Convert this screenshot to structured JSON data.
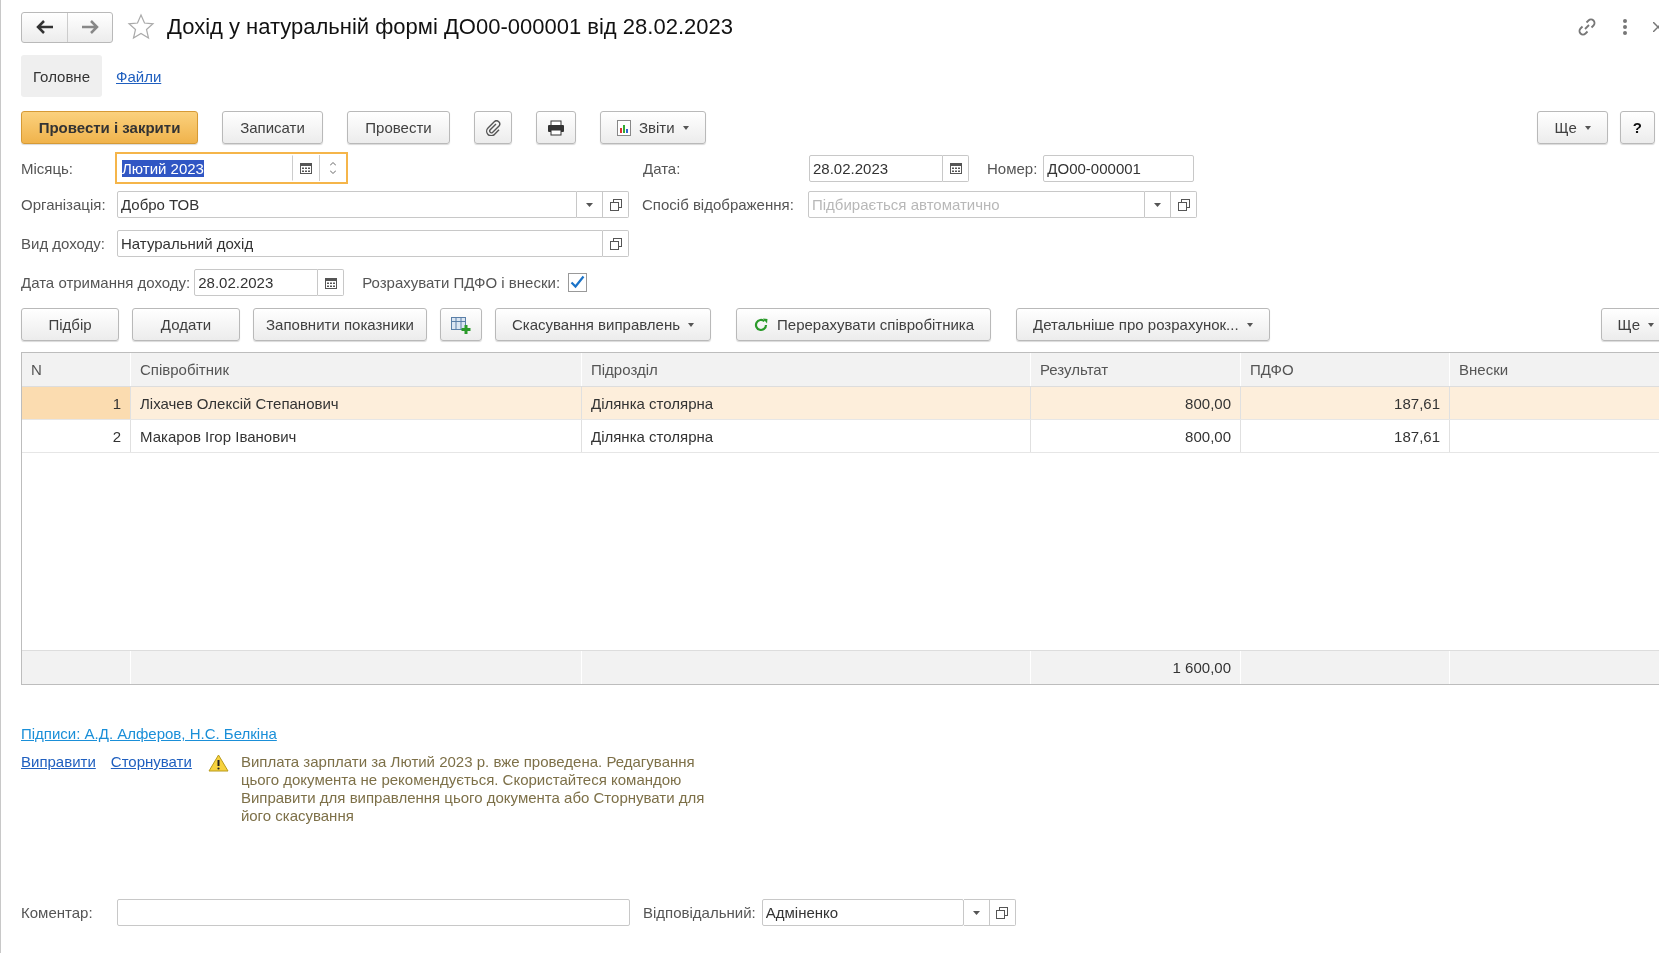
{
  "window": {
    "title": "Дохід у натуральній формі ДО00-000001 від 28.02.2023",
    "favorite": false
  },
  "tabs": [
    {
      "label": "Головне",
      "selected": true
    },
    {
      "label": "Файли",
      "selected": false
    }
  ],
  "toolbar": {
    "post_and_close": "Провести і закрити",
    "save": "Записати",
    "post": "Провести",
    "reports": "Звіти",
    "more": "Ще",
    "help": "?"
  },
  "month": {
    "label": "Місяць:",
    "value": "Лютий 2023",
    "focused": true
  },
  "date": {
    "label": "Дата:",
    "value": "28.02.2023"
  },
  "number": {
    "label": "Номер:",
    "value": "ДО00-000001"
  },
  "organization": {
    "label": "Організація:",
    "value": "Добро ТОВ"
  },
  "display_method": {
    "label": "Спосіб відображення:",
    "placeholder": "Підбирається автоматично"
  },
  "income_type": {
    "label": "Вид доходу:",
    "value": "Натуральний дохід"
  },
  "receipt_date": {
    "label": "Дата отримання доходу:",
    "value": "28.02.2023"
  },
  "calculate_pdfo": {
    "label": "Розрахувати ПДФО і внески:",
    "checked": true
  },
  "table_toolbar": {
    "pick": "Підбір",
    "add": "Додати",
    "fill": "Заповнити показники",
    "cancel_corrections": "Скасування виправлень",
    "recalculate": "Перерахувати співробітника",
    "details": "Детальніше про розрахунок...",
    "more": "Ще"
  },
  "table": {
    "columns": [
      "N",
      "Співробітник",
      "Підрозділ",
      "Результат",
      "ПДФО",
      "Внески"
    ],
    "rows": [
      {
        "n": "1",
        "employee": "Ліхачев Олексій Степанович",
        "department": "Ділянка столярна",
        "result": "800,00",
        "pdfo": "187,61",
        "selected": true
      },
      {
        "n": "2",
        "employee": "Макаров Ігор Іванович",
        "department": "Ділянка столярна",
        "result": "800,00",
        "pdfo": "187,61",
        "selected": false
      }
    ],
    "totals": {
      "result": "1 600,00"
    }
  },
  "signatures": "Підписи: А.Д. Алферов, Н.С. Белкіна",
  "actions": [
    "Виправити",
    "Сторнувати"
  ],
  "warning": "Виплата зарплати за Лютий 2023 р. вже проведена. Редагування цього документа не рекомендується. Скористайтеся командою Виправити для виправлення цього документа або Сторнувати для його скасування",
  "comment": {
    "label": "Коментар:"
  },
  "responsible": {
    "label": "Відповідальний:",
    "value": "Адміненко"
  }
}
